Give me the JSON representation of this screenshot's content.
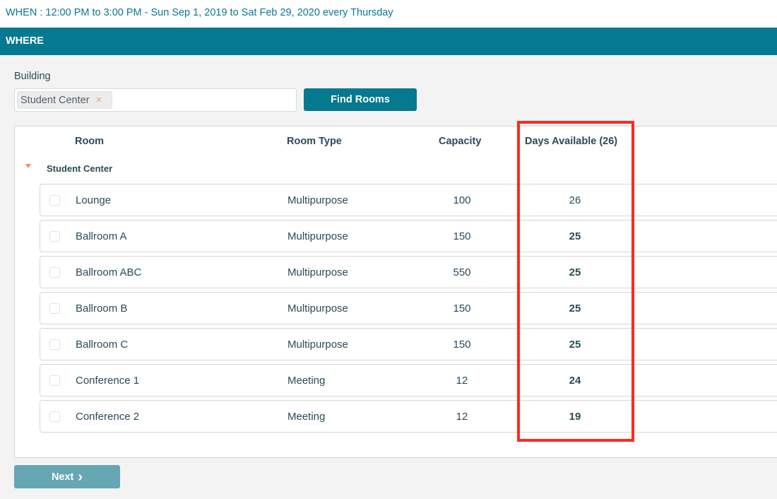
{
  "when": "WHEN : 12:00 PM to 3:00 PM - Sun Sep 1, 2019 to Sat Feb 29, 2020 every Thursday",
  "where_header": "WHERE",
  "building": {
    "label": "Building",
    "selected_tag": "Student Center",
    "remove_icon": "×",
    "find_button": "Find Rooms"
  },
  "table": {
    "columns": [
      "Room",
      "Room Type",
      "Capacity",
      "Days Available (26)"
    ],
    "group": "Student Center",
    "rows": [
      {
        "room": "Lounge",
        "type": "Multipurpose",
        "capacity": "100",
        "days": "26",
        "days_link": false
      },
      {
        "room": "Ballroom A",
        "type": "Multipurpose",
        "capacity": "150",
        "days": "25",
        "days_link": true
      },
      {
        "room": "Ballroom ABC",
        "type": "Multipurpose",
        "capacity": "550",
        "days": "25",
        "days_link": true
      },
      {
        "room": "Ballroom B",
        "type": "Multipurpose",
        "capacity": "150",
        "days": "25",
        "days_link": true
      },
      {
        "room": "Ballroom C",
        "type": "Multipurpose",
        "capacity": "150",
        "days": "25",
        "days_link": true
      },
      {
        "room": "Conference 1",
        "type": "Meeting",
        "capacity": "12",
        "days": "24",
        "days_link": true
      },
      {
        "room": "Conference 2",
        "type": "Meeting",
        "capacity": "12",
        "days": "19",
        "days_link": true
      }
    ]
  },
  "next_button": "Next",
  "next_icon": "›",
  "colors": {
    "accent": "#04798f",
    "highlight": "#ff2a1f",
    "link": "#0b7891"
  }
}
